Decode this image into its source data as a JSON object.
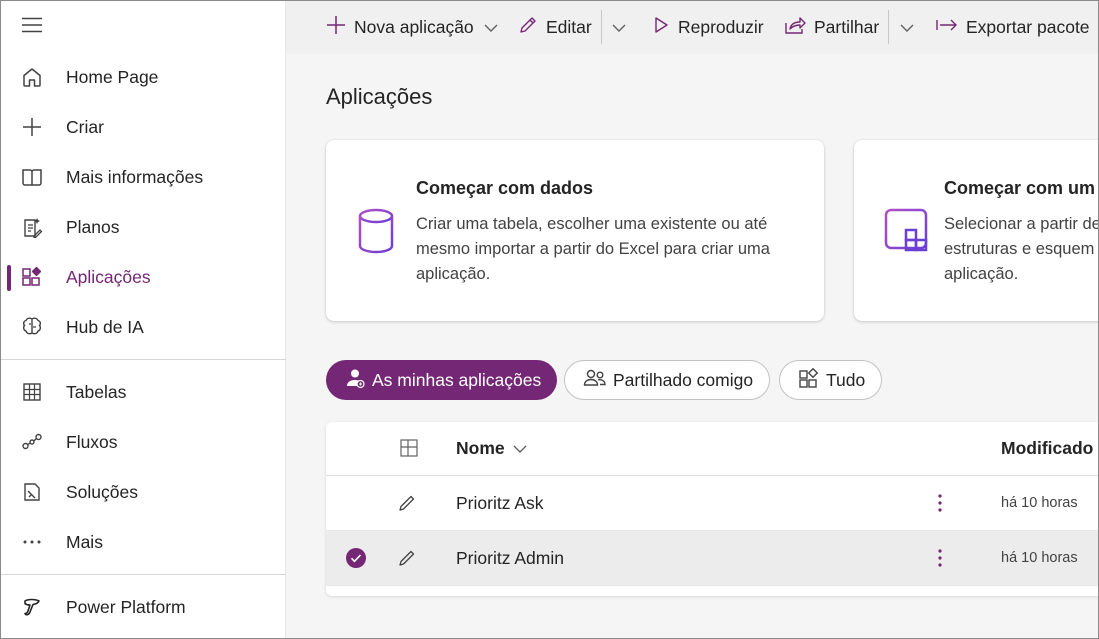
{
  "sidebar": {
    "items": [
      {
        "label": "Home Page",
        "icon": "home-icon"
      },
      {
        "label": "Criar",
        "icon": "plus-icon"
      },
      {
        "label": "Mais informações",
        "icon": "book-icon"
      },
      {
        "label": "Planos",
        "icon": "plan-icon"
      },
      {
        "label": "Aplicações",
        "icon": "apps-icon",
        "active": true
      },
      {
        "label": "Hub de IA",
        "icon": "brain-icon"
      },
      {
        "label": "Tabelas",
        "icon": "table-icon"
      },
      {
        "label": "Fluxos",
        "icon": "flow-icon"
      },
      {
        "label": "Soluções",
        "icon": "solutions-icon"
      },
      {
        "label": "Mais",
        "icon": "more-icon"
      },
      {
        "label": "Power Platform",
        "icon": "power-platform-icon"
      }
    ]
  },
  "toolbar": {
    "new_app": "Nova aplicação",
    "edit": "Editar",
    "play": "Reproduzir",
    "share": "Partilhar",
    "export": "Exportar pacote"
  },
  "main": {
    "title": "Aplicações",
    "cards": [
      {
        "title": "Começar com dados",
        "desc": "Criar uma tabela, escolher uma existente ou até mesmo importar a partir do Excel para criar uma aplicação."
      },
      {
        "title": "Começar com um",
        "desc": "Selecionar a partir de estruturas e esquem aplicação."
      }
    ],
    "filters": [
      {
        "label": "As minhas aplicações",
        "active": true
      },
      {
        "label": "Partilhado comigo"
      },
      {
        "label": "Tudo"
      }
    ],
    "table": {
      "headers": {
        "name": "Nome",
        "modified": "Modificado"
      },
      "rows": [
        {
          "name": "Prioritz Ask",
          "modified": "há 10 horas",
          "selected": false
        },
        {
          "name": "Prioritz Admin",
          "modified": "há 10 horas",
          "selected": true
        }
      ]
    }
  },
  "colors": {
    "accent": "#742774"
  }
}
